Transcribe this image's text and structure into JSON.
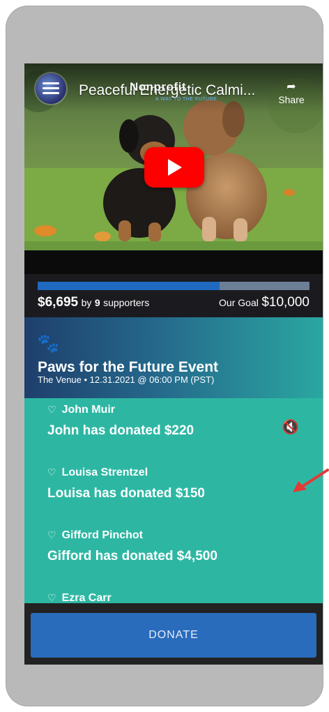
{
  "video": {
    "title": "Peaceful Energetic Calmi...",
    "brand": "Nonprofit",
    "brand_sub": "A WAY TO THE FUTURE",
    "share_label": "Share",
    "play_icon": "play-icon"
  },
  "campaign": {
    "raised_amount": "$6,695",
    "by_text": "by",
    "supporter_count": "9",
    "supporters_text": "supporters",
    "goal_label": "Our Goal",
    "goal_amount": "$10,000",
    "progress_fraction": 0.67
  },
  "event": {
    "logo_icon": "paw-icon",
    "title": "Paws for the Future Event",
    "subtitle": "The Venue • 12.31.2021 @ 06:00 PM (PST)"
  },
  "feed": {
    "items": [
      {
        "name": "John Muir",
        "message": "John has donated $220"
      },
      {
        "name": "Louisa Strentzel",
        "message": "Louisa has donated $150"
      },
      {
        "name": "Gifford Pinchot",
        "message": "Gifford has donated $4,500"
      },
      {
        "name": "Ezra Carr",
        "message": ""
      }
    ],
    "mute_icon": "mute-icon"
  },
  "donate": {
    "label": "DONATE"
  },
  "colors": {
    "accent_blue": "#2a6cbc",
    "teal": "#2db7a3",
    "youtube_red": "#ff0000",
    "annotation_arrow": "#e53935"
  }
}
